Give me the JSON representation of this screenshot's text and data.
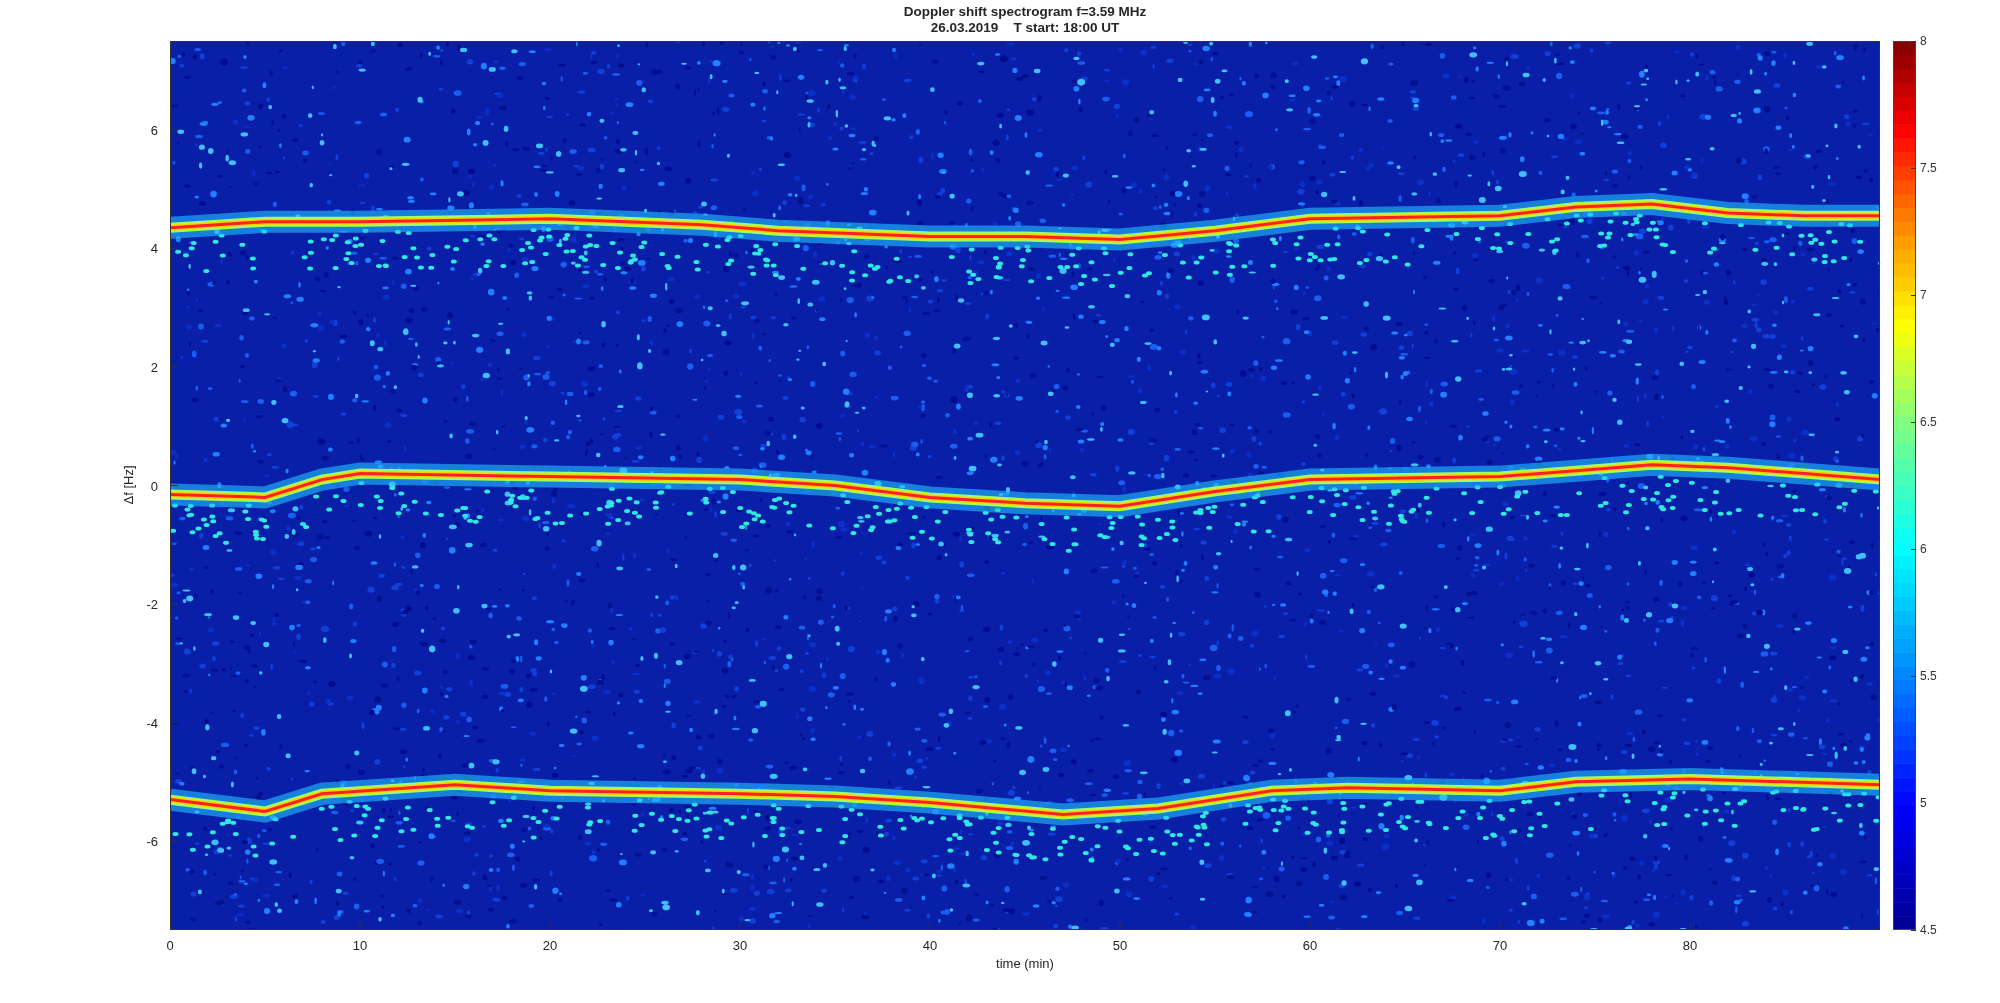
{
  "figure": {
    "title_lines": [
      "Doppler shift spectrogram f=3.59 MHz",
      "26.03.2019    T start: 18:00 UT"
    ],
    "xlabel": "time (min)",
    "ylabel": "Δf [Hz]",
    "xtick_labels": [
      "0",
      "10",
      "20",
      "30",
      "40",
      "50",
      "60",
      "70",
      "80"
    ],
    "ytick_labels": [
      "6",
      "4",
      "2",
      "0",
      "-2",
      "-4",
      "-6"
    ],
    "colorbar_labels": [
      "8",
      "7.5",
      "7",
      "6.5",
      "6",
      "5.5",
      "5",
      "4.5"
    ]
  }
}
